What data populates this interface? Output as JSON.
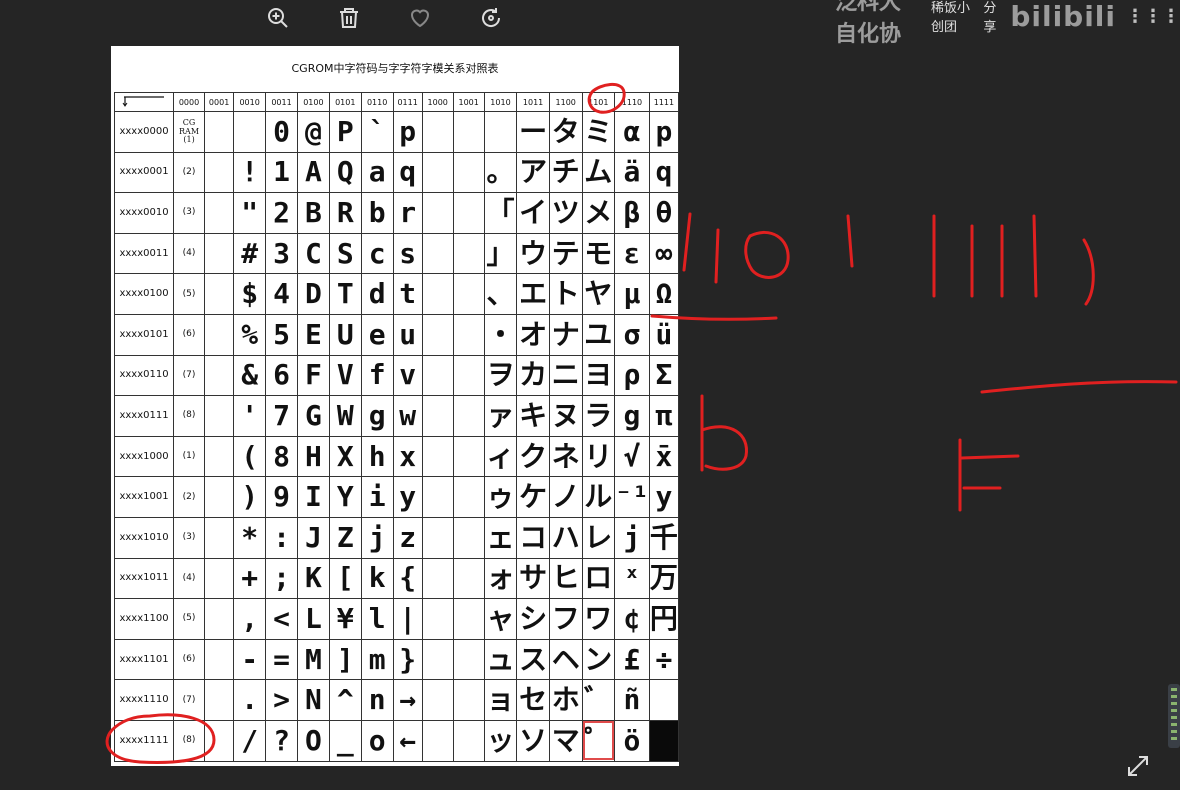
{
  "toolbar": {
    "zoom_in": "zoom-in-icon",
    "delete": "trash-icon",
    "favorite": "heart-icon",
    "rotate": "rotate-icon"
  },
  "watermark": {
    "channel": "泛科大自化协",
    "sub": "稀饭小创团",
    "share": "分享",
    "brand": "bilibili",
    "more": "⋮⋮⋮"
  },
  "doc": {
    "title": "CGROM中字符码与字字符字模关系对照表",
    "col_headers": [
      "0000",
      "0001",
      "0010",
      "0011",
      "0100",
      "0101",
      "0110",
      "0111",
      "1000",
      "1001",
      "1010",
      "1011",
      "1100",
      "1101",
      "1110",
      "1111"
    ],
    "cgram_label": "CG RAM (1)",
    "rows": [
      {
        "label": "xxxx0000",
        "cg": "",
        "chars": [
          "",
          "0",
          "@",
          "P",
          "`",
          "p",
          "",
          "",
          "",
          "ー",
          "タ",
          "ミ",
          "α",
          "p"
        ]
      },
      {
        "label": "xxxx0001",
        "cg": "(2)",
        "chars": [
          "!",
          "1",
          "A",
          "Q",
          "a",
          "q",
          "",
          "",
          "。",
          "ア",
          "チ",
          "ム",
          "ä",
          "q"
        ]
      },
      {
        "label": "xxxx0010",
        "cg": "(3)",
        "chars": [
          "\"",
          "2",
          "B",
          "R",
          "b",
          "r",
          "",
          "",
          "「",
          "イ",
          "ツ",
          "メ",
          "β",
          "θ"
        ]
      },
      {
        "label": "xxxx0011",
        "cg": "(4)",
        "chars": [
          "#",
          "3",
          "C",
          "S",
          "c",
          "s",
          "",
          "",
          "」",
          "ウ",
          "テ",
          "モ",
          "ε",
          "∞"
        ]
      },
      {
        "label": "xxxx0100",
        "cg": "(5)",
        "chars": [
          "$",
          "4",
          "D",
          "T",
          "d",
          "t",
          "",
          "",
          "、",
          "エ",
          "ト",
          "ヤ",
          "μ",
          "Ω"
        ]
      },
      {
        "label": "xxxx0101",
        "cg": "(6)",
        "chars": [
          "%",
          "5",
          "E",
          "U",
          "e",
          "u",
          "",
          "",
          "・",
          "オ",
          "ナ",
          "ユ",
          "σ",
          "ü"
        ]
      },
      {
        "label": "xxxx0110",
        "cg": "(7)",
        "chars": [
          "&",
          "6",
          "F",
          "V",
          "f",
          "v",
          "",
          "",
          "ヲ",
          "カ",
          "ニ",
          "ヨ",
          "ρ",
          "Σ"
        ]
      },
      {
        "label": "xxxx0111",
        "cg": "(8)",
        "chars": [
          "'",
          "7",
          "G",
          "W",
          "g",
          "w",
          "",
          "",
          "ァ",
          "キ",
          "ヌ",
          "ラ",
          "g",
          "π"
        ]
      },
      {
        "label": "xxxx1000",
        "cg": "(1)",
        "chars": [
          "(",
          "8",
          "H",
          "X",
          "h",
          "x",
          "",
          "",
          "ィ",
          "ク",
          "ネ",
          "リ",
          "√",
          "x̄"
        ]
      },
      {
        "label": "xxxx1001",
        "cg": "(2)",
        "chars": [
          ")",
          "9",
          "I",
          "Y",
          "i",
          "y",
          "",
          "",
          "ゥ",
          "ケ",
          "ノ",
          "ル",
          "⁻¹",
          "y"
        ]
      },
      {
        "label": "xxxx1010",
        "cg": "(3)",
        "chars": [
          "*",
          ":",
          "J",
          "Z",
          "j",
          "z",
          "",
          "",
          "ェ",
          "コ",
          "ハ",
          "レ",
          "j",
          "千"
        ]
      },
      {
        "label": "xxxx1011",
        "cg": "(4)",
        "chars": [
          "+",
          ";",
          "K",
          "[",
          "k",
          "{",
          "",
          "",
          "ォ",
          "サ",
          "ヒ",
          "ロ",
          "ˣ",
          "万"
        ]
      },
      {
        "label": "xxxx1100",
        "cg": "(5)",
        "chars": [
          ",",
          "<",
          "L",
          "¥",
          "l",
          "|",
          "",
          "",
          "ャ",
          "シ",
          "フ",
          "ワ",
          "¢",
          "円"
        ]
      },
      {
        "label": "xxxx1101",
        "cg": "(6)",
        "chars": [
          "-",
          "=",
          "M",
          "]",
          "m",
          "}",
          "",
          "",
          "ュ",
          "ス",
          "ヘ",
          "ン",
          "£",
          "÷"
        ]
      },
      {
        "label": "xxxx1110",
        "cg": "(7)",
        "chars": [
          ".",
          ">",
          "N",
          "^",
          "n",
          "→",
          "",
          "",
          "ョ",
          "セ",
          "ホ",
          "゛",
          "ñ",
          ""
        ]
      },
      {
        "label": "xxxx1111",
        "cg": "(8)",
        "chars": [
          "/",
          "?",
          "O",
          "_",
          "o",
          "←",
          "",
          "",
          "ッ",
          "ソ",
          "マ",
          "゜",
          "ö",
          ""
        ]
      }
    ]
  },
  "colors": {
    "background": "#252525",
    "annotation": "#e02020",
    "document": "#ffffff"
  }
}
